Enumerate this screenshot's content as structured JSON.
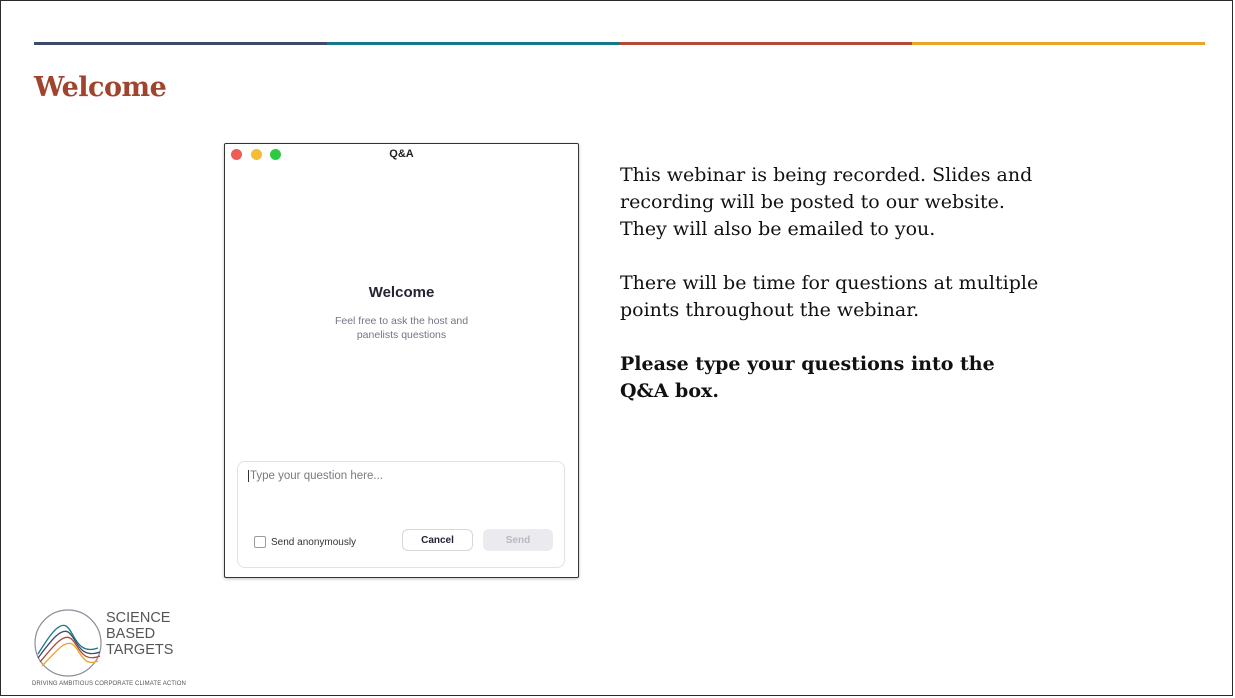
{
  "colors": {
    "title": "#a0442d",
    "rule": [
      "#3f4a68",
      "#17788a",
      "#b24a35",
      "#eba42a"
    ],
    "traffic": [
      "#ee5c55",
      "#f4bd35",
      "#2fc945"
    ]
  },
  "slide": {
    "title": "Welcome"
  },
  "qa": {
    "window_title": "Q&A",
    "welcome_heading": "Welcome",
    "welcome_sub": "Feel free to ask the host and panelists questions",
    "input_placeholder": "Type your question here...",
    "anonymous_label": "Send anonymously",
    "cancel_label": "Cancel",
    "send_label": "Send"
  },
  "body": {
    "paragraph1": "This webinar is being recorded. Slides and recording will be posted to our website. They will also be emailed to you.",
    "paragraph2": "There will be time for questions at multiple points throughout the webinar.",
    "paragraph3": "Please type your questions into the Q&A box."
  },
  "logo": {
    "line1": "SCIENCE",
    "line2": "BASED",
    "line3": "TARGETS",
    "tagline": "DRIVING AMBITIOUS CORPORATE CLIMATE ACTION"
  }
}
